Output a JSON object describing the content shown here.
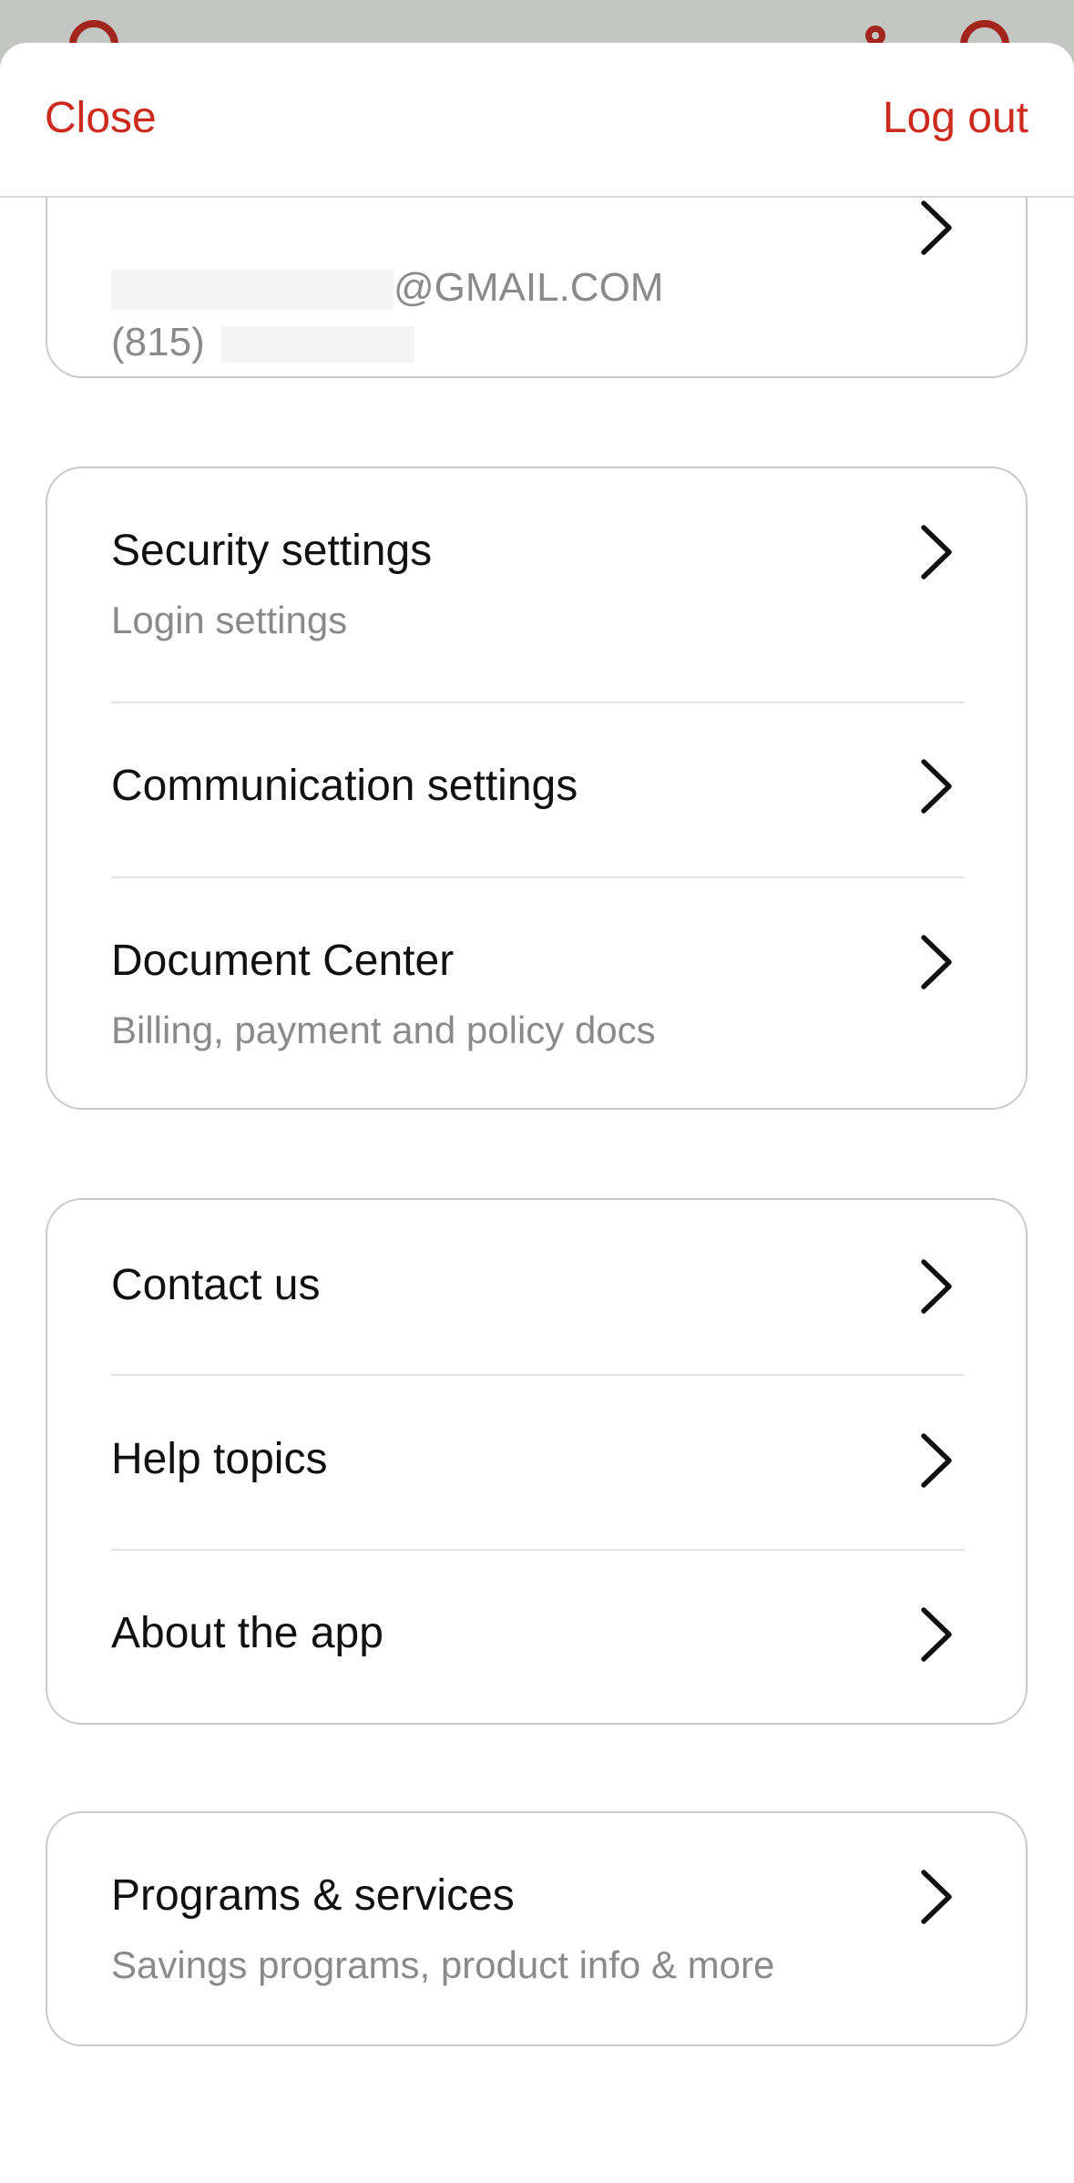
{
  "header": {
    "close_label": "Close",
    "logout_label": "Log out",
    "accent_color": "#cc2a1c"
  },
  "profile": {
    "email_suffix": "@GMAIL.COM",
    "phone_prefix": "(815)"
  },
  "account_group": {
    "items": [
      {
        "title": "Security settings",
        "subtitle": "Login settings"
      },
      {
        "title": "Communication settings"
      },
      {
        "title": "Document Center",
        "subtitle": "Billing, payment and policy docs"
      }
    ]
  },
  "help_group": {
    "items": [
      {
        "title": "Contact us"
      },
      {
        "title": "Help topics"
      },
      {
        "title": "About the app"
      }
    ]
  },
  "programs_group": {
    "items": [
      {
        "title": "Programs & services",
        "subtitle": "Savings programs, product info & more"
      }
    ]
  },
  "icons": {
    "row_chevron": "chevron-right-icon"
  }
}
